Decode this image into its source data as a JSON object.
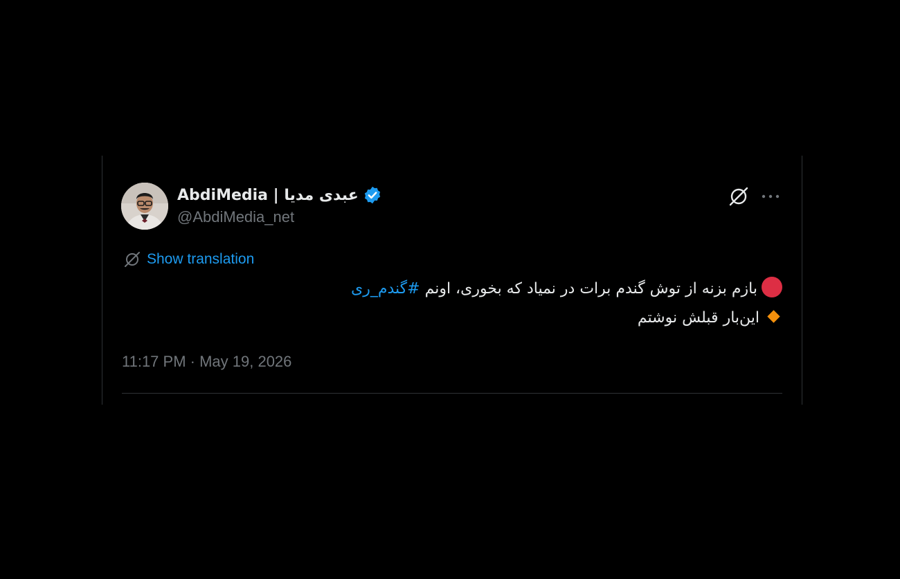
{
  "tweet": {
    "author": {
      "display_name": "AbdiMedia | عبدی مدیا",
      "handle": "@AbdiMedia_net",
      "verified": true
    },
    "show_translation_label": "Show translation",
    "body": {
      "line1_text": "بازم بزنه از توش گندم برات در نمیاد که بخوری، اونم",
      "line1_hashtag": "#گندم_ری",
      "line2_text": "این‌بار قبلش نوشتم"
    },
    "timestamp": "11:17 PM · May 19, 2026"
  },
  "icons": {
    "verified": "verified-badge-icon",
    "grok": "grok-icon",
    "more": "more-options-icon",
    "translate": "translate-icon",
    "line1_emoji": "red-circle-icon",
    "line2_emoji": "orange-diamond-icon"
  },
  "colors": {
    "background": "#000000",
    "text_primary": "#e7e9ea",
    "text_secondary": "#71767b",
    "accent": "#1d9bf0",
    "border": "#2f3336",
    "red_circle": "#dd2e44",
    "orange_diamond": "#f4900c"
  }
}
